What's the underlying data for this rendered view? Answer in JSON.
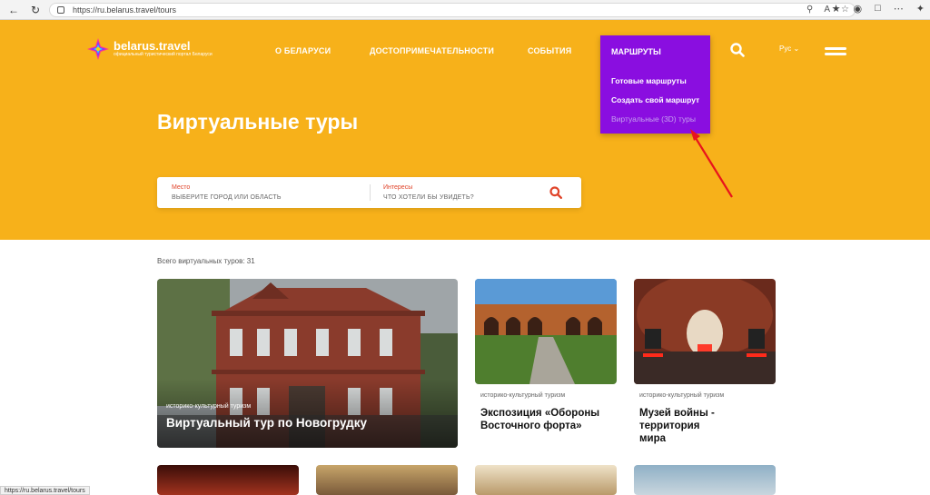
{
  "browser": {
    "url": "https://ru.belarus.travel/tours",
    "status_url": "https://ru.belarus.travel/tours"
  },
  "header": {
    "brand": "belarus.travel",
    "tagline": "официальный туристический портал Беларуси",
    "nav": [
      "О БЕЛАРУСИ",
      "ДОСТОПРИМЕЧАТЕЛЬНОСТИ",
      "СОБЫТИЯ"
    ],
    "lang": "Рус"
  },
  "dropdown": {
    "title": "МАРШРУТЫ",
    "items": [
      "Готовые маршруты",
      "Создать свой маршрут",
      "Виртуальные (3D) туры"
    ]
  },
  "hero": {
    "title": "Виртуальные туры"
  },
  "search": {
    "place_label": "Место",
    "place_placeholder": "ВЫБЕРИТЕ ГОРОД ИЛИ ОБЛАСТЬ",
    "interest_label": "Интересы",
    "interest_placeholder": "ЧТО ХОТЕЛИ БЫ УВИДЕТЬ?"
  },
  "content": {
    "count_text": "Всего виртуальных туров: 31",
    "cards": [
      {
        "category": "историко-культурный туризм",
        "title": "Виртуальный тур по Новогрудку"
      },
      {
        "category": "историко-культурный туризм",
        "title_line1": "Экспозиция «Обороны",
        "title_line2": "Восточного форта»"
      },
      {
        "category": "историко-культурный туризм",
        "title_line1": "Музей войны - территория",
        "title_line2": "мира"
      }
    ]
  },
  "colors": {
    "hero": "#f7b11a",
    "dropdown": "#8a0ee0",
    "accent": "#e0442a"
  }
}
